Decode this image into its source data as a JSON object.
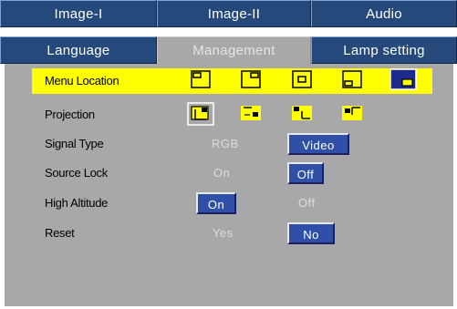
{
  "tabs_row1": [
    {
      "label": "Image-I"
    },
    {
      "label": "Image-II"
    },
    {
      "label": "Audio"
    }
  ],
  "tabs_row2": [
    {
      "label": "Language"
    },
    {
      "label": "Management"
    },
    {
      "label": "Lamp setting"
    }
  ],
  "menu": {
    "menu_location": {
      "label": "Menu Location",
      "icons": [
        "menu-position-top-left-icon",
        "menu-position-top-right-icon",
        "menu-position-center-icon",
        "menu-position-bottom-left-icon",
        "menu-position-bottom-right-icon"
      ],
      "selected": "menu-position-bottom-right-icon"
    },
    "projection": {
      "label": "Projection",
      "icons": [
        "front-desktop-icon",
        "rear-desktop-icon",
        "front-ceiling-icon",
        "rear-ceiling-icon"
      ],
      "selected": "front-desktop-icon"
    },
    "signal_type": {
      "label": "Signal Type",
      "options": [
        "RGB",
        "Video"
      ],
      "selected": "Video"
    },
    "source_lock": {
      "label": "Source Lock",
      "options": [
        "On",
        "Off"
      ],
      "selected": "Off"
    },
    "high_altitude": {
      "label": "High Altitude",
      "options": [
        "On",
        "Off"
      ],
      "selected": "On"
    },
    "reset": {
      "label": "Reset",
      "options": [
        "Yes",
        "No"
      ],
      "selected": "No"
    }
  },
  "colors": {
    "tab_bg": "#24497a",
    "tab_active_bg": "#a8a8a8",
    "panel_bg": "#a8a8a8",
    "highlight": "#ffff00",
    "selected_option": "#3050a8"
  }
}
